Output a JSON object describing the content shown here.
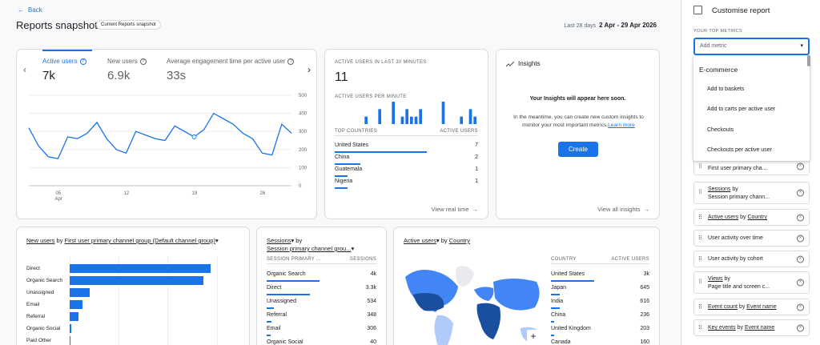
{
  "header": {
    "back_label": "Back",
    "title": "Reports snapshot",
    "badge": "Current Reports snapshot",
    "date_prefix": "Last 28 days",
    "date_range": "2 Apr - 29 Apr 2026"
  },
  "overview": {
    "metrics": [
      {
        "label": "Active users",
        "value": "7k"
      },
      {
        "label": "New users",
        "value": "6.9k"
      },
      {
        "label": "Average engagement time per active user",
        "value": "33s"
      }
    ],
    "y_ticks": [
      "500",
      "400",
      "300",
      "200",
      "100",
      "0"
    ],
    "x_ticks": [
      "05",
      "12",
      "19",
      "26"
    ],
    "x_sub": "Apr"
  },
  "realtime": {
    "title": "ACTIVE USERS IN LAST 30 MINUTES",
    "value": "11",
    "per_minute_label": "ACTIVE USERS PER MINUTE",
    "col_country": "TOP COUNTRIES",
    "col_users": "ACTIVE USERS",
    "rows": [
      {
        "country": "United States",
        "users": "7",
        "share": 1.0
      },
      {
        "country": "China",
        "users": "2",
        "share": 0.28
      },
      {
        "country": "Guatemala",
        "users": "1",
        "share": 0.14
      },
      {
        "country": "Nigeria",
        "users": "1",
        "share": 0.14
      }
    ],
    "link": "View real time"
  },
  "insights": {
    "title": "Insights",
    "heading": "Your Insights will appear here soon.",
    "body": "In the meantime, you can create new custom insights to monitor your most important metrics.",
    "body_link": "Learn more",
    "button": "Create",
    "link": "View all insights"
  },
  "new_users_card": {
    "title_metric": "New users",
    "title_by": "by",
    "title_dimension": "First user primary channel group (Default channel group)",
    "title_caret": "▾",
    "rows": [
      {
        "label": "Direct",
        "share": 1.0
      },
      {
        "label": "Organic Search",
        "share": 0.95
      },
      {
        "label": "Unassigned",
        "share": 0.14
      },
      {
        "label": "Email",
        "share": 0.09
      },
      {
        "label": "Referral",
        "share": 0.06
      },
      {
        "label": "Organic Social",
        "share": 0.01
      },
      {
        "label": "Paid Other",
        "share": 0.005
      }
    ]
  },
  "sessions_card": {
    "title_metric": "Sessions",
    "title_metric_caret": "▾",
    "title_by": "by",
    "title_dimension": "Session primary channel grou...",
    "title_dimension_caret": "▾",
    "col_dim": "SESSION PRIMARY ...",
    "col_val": "SESSIONS",
    "rows": [
      {
        "label": "Organic Search",
        "value": "4k",
        "share": 1.0
      },
      {
        "label": "Direct",
        "value": "3.3k",
        "share": 0.82
      },
      {
        "label": "Unassigned",
        "value": "534",
        "share": 0.13
      },
      {
        "label": "Referral",
        "value": "348",
        "share": 0.09
      },
      {
        "label": "Email",
        "value": "306",
        "share": 0.08
      },
      {
        "label": "Organic Social",
        "value": "40",
        "share": 0.01
      }
    ]
  },
  "country_card": {
    "title_metric": "Active users",
    "title_metric_caret": "▾",
    "title_by": "by",
    "title_dimension": "Country",
    "col_dim": "COUNTRY",
    "col_val": "ACTIVE USERS",
    "zoom_in": "+",
    "rows": [
      {
        "label": "United States",
        "value": "3k",
        "share": 1.0
      },
      {
        "label": "Japan",
        "value": "645",
        "share": 0.21
      },
      {
        "label": "India",
        "value": "616",
        "share": 0.2
      },
      {
        "label": "China",
        "value": "236",
        "share": 0.08
      },
      {
        "label": "United Kingdom",
        "value": "203",
        "share": 0.07
      },
      {
        "label": "Canada",
        "value": "160",
        "share": 0.05
      }
    ]
  },
  "panel": {
    "title": "Customise report",
    "section": "YOUR TOP METRICS",
    "add_placeholder": "Add metric",
    "dropdown_caret": "▾",
    "dropdown_group": "E-commerce",
    "dropdown_items": [
      "Add to baskets",
      "Add to carts per active user",
      "Checkouts",
      "Checkouts per active user"
    ],
    "drag_glyph": "⠿",
    "close_glyph": "×",
    "cards": [
      {
        "line1": "",
        "line2": "First user primary cha..."
      },
      {
        "line1_metric": "Sessions",
        "line1_by": "by",
        "line2": "Session primary chann..."
      },
      {
        "metric": "Active users",
        "by": "by",
        "dim": "Country"
      },
      {
        "text": "User activity over time"
      },
      {
        "text": "User activity by cohort"
      },
      {
        "line1_metric": "Views",
        "line1_by": "by",
        "line2": "Page title and screen c..."
      },
      {
        "metric": "Event count",
        "by": "by",
        "dim": "Event name"
      },
      {
        "metric": "Key events",
        "by": "by",
        "dim": "Event name"
      }
    ]
  },
  "colors": {
    "accent": "#1a73e8",
    "map_dark": "#1a4fa0",
    "map_mid": "#4285f4",
    "map_light": "#aecbfa"
  },
  "chart_data": [
    {
      "type": "line",
      "title": "",
      "xlabel": "",
      "ylabel": "",
      "x": [
        "2 Apr",
        "3 Apr",
        "4 Apr",
        "5 Apr",
        "6 Apr",
        "7 Apr",
        "8 Apr",
        "9 Apr",
        "10 Apr",
        "11 Apr",
        "12 Apr",
        "13 Apr",
        "14 Apr",
        "15 Apr",
        "16 Apr",
        "17 Apr",
        "18 Apr",
        "19 Apr",
        "20 Apr",
        "21 Apr",
        "22 Apr",
        "23 Apr",
        "24 Apr",
        "25 Apr",
        "26 Apr",
        "27 Apr",
        "28 Apr",
        "29 Apr"
      ],
      "series": [
        {
          "values": [
            320,
            220,
            160,
            150,
            270,
            260,
            290,
            350,
            260,
            200,
            180,
            300,
            280,
            260,
            250,
            330,
            300,
            270,
            310,
            400,
            370,
            340,
            290,
            260,
            180,
            170,
            340,
            290
          ]
        }
      ],
      "ylim": [
        0,
        500
      ],
      "grid": true
    },
    {
      "type": "bar",
      "title": "",
      "series": [
        {
          "values": [
            0,
            0,
            0,
            0,
            0,
            1,
            0,
            0,
            2,
            0,
            0,
            3,
            0,
            1,
            2,
            1,
            1,
            2,
            0,
            0,
            0,
            0,
            3,
            0,
            0,
            0,
            1,
            0,
            2,
            1
          ]
        }
      ],
      "grid": false
    }
  ]
}
